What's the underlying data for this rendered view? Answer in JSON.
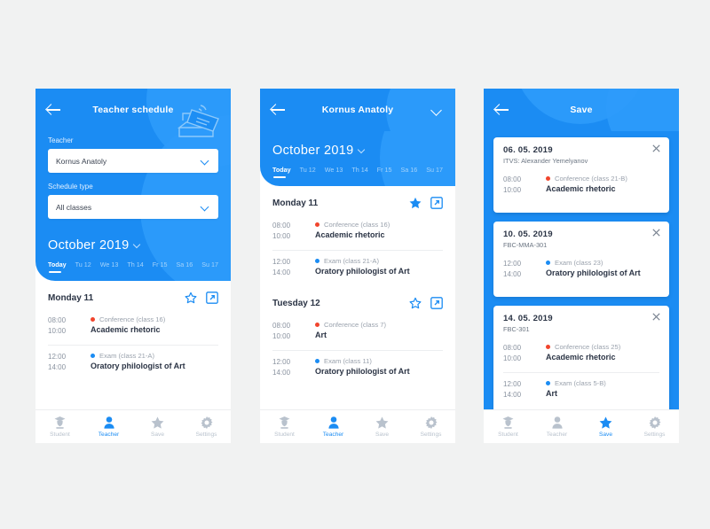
{
  "theme": {
    "brand_blue": "#1b8cf3",
    "blue_light": "#2e9bfb",
    "dot_red": "#f1452d",
    "dot_blue": "#1b8cf3",
    "text_dark": "#2b3445",
    "text_muted": "#8a93a0",
    "page_bg": "#f1f2f2"
  },
  "screens": [
    {
      "id": "teacher-schedule",
      "header": {
        "title": "Teacher schedule",
        "back_icon": "back-arrow-icon",
        "hero_icon": "card-reader-illustration"
      },
      "form": {
        "teacher_label": "Teacher",
        "teacher_value": "Kornus Anatoly",
        "schedule_type_label": "Schedule type",
        "schedule_type_value": "All classes"
      },
      "calendar": {
        "month": "October 2019",
        "days": [
          {
            "label": "Today",
            "active": true
          },
          {
            "label": "Tu 12",
            "active": false
          },
          {
            "label": "We 13",
            "active": false
          },
          {
            "label": "Th 14",
            "active": false
          },
          {
            "label": "Fr 15",
            "active": false
          },
          {
            "label": "Sa 16",
            "active": false
          },
          {
            "label": "Su 17",
            "active": false
          }
        ]
      },
      "schedule": [
        {
          "day": "Monday 11",
          "starred": false,
          "events": [
            {
              "start": "08:00",
              "end": "10:00",
              "type": "Conference (class 16)",
              "dot": "#f1452d",
              "name": "Academic rhetoric"
            },
            {
              "start": "12:00",
              "end": "14:00",
              "type": "Exam (class 21-A)",
              "dot": "#1b8cf3",
              "name": "Oratory philologist of Art"
            }
          ]
        }
      ],
      "nav": [
        {
          "label": "Student",
          "icon": "student-icon",
          "active": false
        },
        {
          "label": "Teacher",
          "icon": "teacher-icon",
          "active": true
        },
        {
          "label": "Save",
          "icon": "star-icon",
          "active": false
        },
        {
          "label": "Settings",
          "icon": "gear-icon",
          "active": false
        }
      ]
    },
    {
      "id": "teacher-detail",
      "header": {
        "title": "Kornus Anatoly",
        "back_icon": "back-arrow-icon",
        "dropdown_icon": "chevron-down-icon"
      },
      "calendar": {
        "month": "October 2019",
        "days": [
          {
            "label": "Today",
            "active": true
          },
          {
            "label": "Tu 12",
            "active": false
          },
          {
            "label": "We 13",
            "active": false
          },
          {
            "label": "Th 14",
            "active": false
          },
          {
            "label": "Fr 15",
            "active": false
          },
          {
            "label": "Sa 16",
            "active": false
          },
          {
            "label": "Su 17",
            "active": false
          }
        ]
      },
      "schedule": [
        {
          "day": "Monday 11",
          "starred": true,
          "events": [
            {
              "start": "08:00",
              "end": "10:00",
              "type": "Conference (class 16)",
              "dot": "#f1452d",
              "name": "Academic rhetoric"
            },
            {
              "start": "12:00",
              "end": "14:00",
              "type": "Exam (class 21-A)",
              "dot": "#1b8cf3",
              "name": "Oratory philologist of Art"
            }
          ]
        },
        {
          "day": "Tuesday 12",
          "starred": false,
          "events": [
            {
              "start": "08:00",
              "end": "10:00",
              "type": "Conference (class 7)",
              "dot": "#f1452d",
              "name": "Art"
            },
            {
              "start": "12:00",
              "end": "14:00",
              "type": "Exam (class 11)",
              "dot": "#1b8cf3",
              "name": "Oratory philologist of Art"
            }
          ]
        }
      ],
      "nav": [
        {
          "label": "Student",
          "icon": "student-icon",
          "active": false
        },
        {
          "label": "Teacher",
          "icon": "teacher-icon",
          "active": true
        },
        {
          "label": "Save",
          "icon": "star-icon",
          "active": false
        },
        {
          "label": "Settings",
          "icon": "gear-icon",
          "active": false
        }
      ]
    },
    {
      "id": "saved",
      "header": {
        "title": "Save",
        "back_icon": "back-arrow-icon"
      },
      "cards": [
        {
          "date": "06. 05. 2019",
          "subtitle": "ITVS: Alexander Yemelyanov",
          "close_icon": "close-icon",
          "events": [
            {
              "start": "08:00",
              "end": "10:00",
              "type": "Conference (class 21-B)",
              "dot": "#f1452d",
              "name": "Academic rhetoric"
            }
          ]
        },
        {
          "date": "10. 05. 2019",
          "subtitle": "FBC-MMA-301",
          "close_icon": "close-icon",
          "events": [
            {
              "start": "12:00",
              "end": "14:00",
              "type": "Exam (class 23)",
              "dot": "#1b8cf3",
              "name": "Oratory philologist of Art"
            }
          ]
        },
        {
          "date": "14. 05. 2019",
          "subtitle": "FBC-301",
          "close_icon": "close-icon",
          "events": [
            {
              "start": "08:00",
              "end": "10:00",
              "type": "Conference (class 25)",
              "dot": "#f1452d",
              "name": "Academic rhetoric"
            },
            {
              "start": "12:00",
              "end": "14:00",
              "type": "Exam (class 5-B)",
              "dot": "#1b8cf3",
              "name": "Art"
            }
          ]
        }
      ],
      "nav": [
        {
          "label": "Student",
          "icon": "student-icon",
          "active": false
        },
        {
          "label": "Teacher",
          "icon": "teacher-icon",
          "active": false
        },
        {
          "label": "Save",
          "icon": "star-icon",
          "active": true
        },
        {
          "label": "Settings",
          "icon": "gear-icon",
          "active": false
        }
      ]
    }
  ]
}
